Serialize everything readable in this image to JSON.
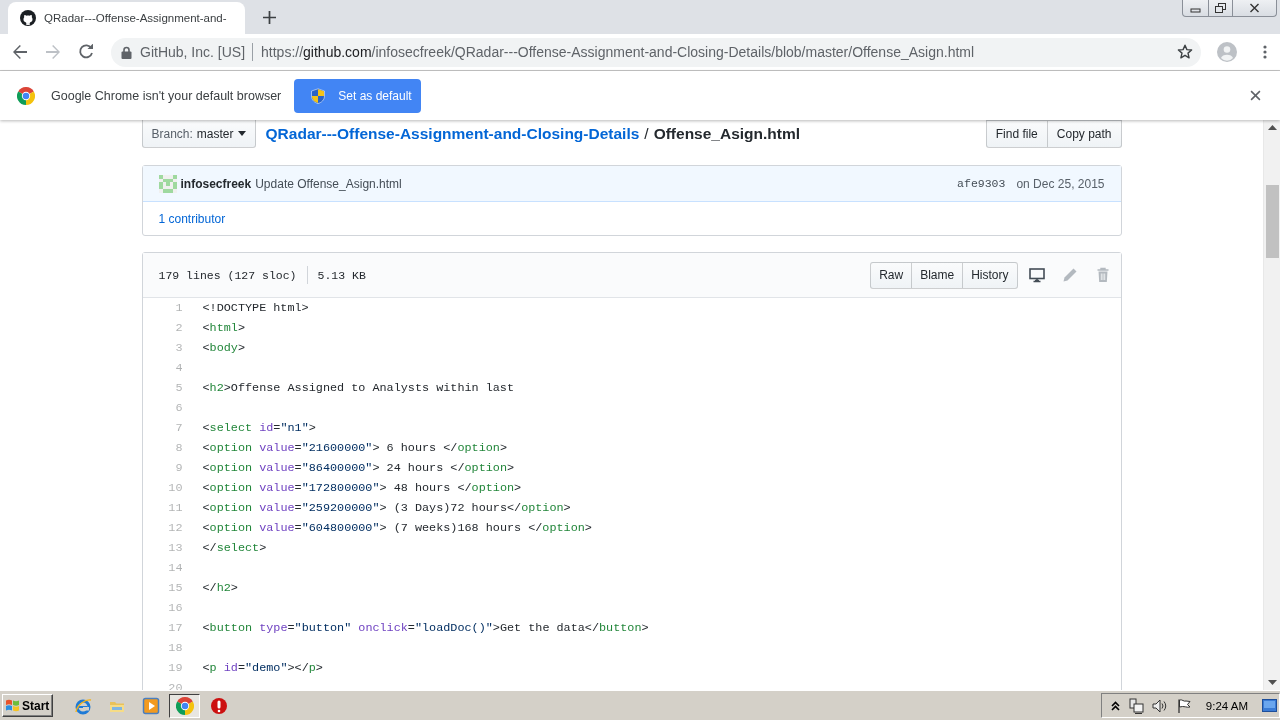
{
  "tabs": [
    {
      "title": "QRadar---Offense-Assignment-and-",
      "selected": true
    }
  ],
  "toolbar": {
    "back_disabled": false,
    "forward_disabled": true,
    "site_identity": "GitHub, Inc. [US]",
    "url": {
      "scheme": "https://",
      "host": "github.com",
      "path": "/infosecfreek/QRadar---Offense-Assignment-and-Closing-Details/blob/master/Offense_Asign.html"
    }
  },
  "infobar": {
    "message": "Google Chrome isn't your default browser",
    "button": "Set as default"
  },
  "file_nav": {
    "branch_label": "Branch:",
    "branch": "master",
    "repo": "QRadar---Offense-Assignment-and-Closing-Details",
    "separator": "/",
    "file": "Offense_Asign.html",
    "buttons": [
      "Find file",
      "Copy path"
    ]
  },
  "commit": {
    "author": "infosecfreek",
    "message": "Update Offense_Asign.html",
    "sha": "afe9303",
    "date": "on Dec 25, 2015",
    "contributors": "1 contributor"
  },
  "file": {
    "lines_info": "179 lines (127 sloc)",
    "size": "5.13 KB",
    "buttons": [
      "Raw",
      "Blame",
      "History"
    ],
    "actions": [
      {
        "disabled": false
      },
      {
        "disabled": true
      },
      {
        "disabled": true
      }
    ],
    "lines": [
      {
        "number": "1",
        "tokens": [
          {
            "kind": "plain",
            "text": "<!DOCTYPE html>"
          }
        ]
      },
      {
        "number": "2",
        "tokens": [
          {
            "kind": "plain",
            "text": "<"
          },
          {
            "kind": "tag",
            "text": "html"
          },
          {
            "kind": "plain",
            "text": ">"
          }
        ]
      },
      {
        "number": "3",
        "tokens": [
          {
            "kind": "plain",
            "text": "<"
          },
          {
            "kind": "tag",
            "text": "body"
          },
          {
            "kind": "plain",
            "text": ">"
          }
        ]
      },
      {
        "number": "4"
      },
      {
        "number": "5",
        "tokens": [
          {
            "kind": "plain",
            "text": "<"
          },
          {
            "kind": "tag",
            "text": "h2"
          },
          {
            "kind": "plain",
            "text": ">Offense Assigned to Analysts within last"
          }
        ]
      },
      {
        "number": "6"
      },
      {
        "number": "7",
        "tokens": [
          {
            "kind": "plain",
            "text": "<"
          },
          {
            "kind": "tag",
            "text": "select"
          },
          {
            "kind": "attr",
            "text": " id"
          },
          {
            "kind": "plain",
            "text": "="
          },
          {
            "kind": "string",
            "text": "\"n1\""
          },
          {
            "kind": "plain",
            "text": ">"
          }
        ]
      },
      {
        "number": "8",
        "tokens": [
          {
            "kind": "plain",
            "text": "<"
          },
          {
            "kind": "tag",
            "text": "option"
          },
          {
            "kind": "attr",
            "text": " value"
          },
          {
            "kind": "plain",
            "text": "="
          },
          {
            "kind": "string",
            "text": "\"21600000\""
          },
          {
            "kind": "plain",
            "text": "> 6 hours </"
          },
          {
            "kind": "tag",
            "text": "option"
          },
          {
            "kind": "plain",
            "text": ">"
          }
        ]
      },
      {
        "number": "9",
        "tokens": [
          {
            "kind": "plain",
            "text": "<"
          },
          {
            "kind": "tag",
            "text": "option"
          },
          {
            "kind": "attr",
            "text": " value"
          },
          {
            "kind": "plain",
            "text": "="
          },
          {
            "kind": "string",
            "text": "\"86400000\""
          },
          {
            "kind": "plain",
            "text": "> 24 hours </"
          },
          {
            "kind": "tag",
            "text": "option"
          },
          {
            "kind": "plain",
            "text": ">"
          }
        ]
      },
      {
        "number": "10",
        "tokens": [
          {
            "kind": "plain",
            "text": "<"
          },
          {
            "kind": "tag",
            "text": "option"
          },
          {
            "kind": "attr",
            "text": " value"
          },
          {
            "kind": "plain",
            "text": "="
          },
          {
            "kind": "string",
            "text": "\"172800000\""
          },
          {
            "kind": "plain",
            "text": "> 48 hours </"
          },
          {
            "kind": "tag",
            "text": "option"
          },
          {
            "kind": "plain",
            "text": ">"
          }
        ]
      },
      {
        "number": "11",
        "tokens": [
          {
            "kind": "plain",
            "text": "<"
          },
          {
            "kind": "tag",
            "text": "option"
          },
          {
            "kind": "attr",
            "text": " value"
          },
          {
            "kind": "plain",
            "text": "="
          },
          {
            "kind": "string",
            "text": "\"259200000\""
          },
          {
            "kind": "plain",
            "text": "> (3 Days)72 hours</"
          },
          {
            "kind": "tag",
            "text": "option"
          },
          {
            "kind": "plain",
            "text": ">"
          }
        ]
      },
      {
        "number": "12",
        "tokens": [
          {
            "kind": "plain",
            "text": "<"
          },
          {
            "kind": "tag",
            "text": "option"
          },
          {
            "kind": "attr",
            "text": " value"
          },
          {
            "kind": "plain",
            "text": "="
          },
          {
            "kind": "string",
            "text": "\"604800000\""
          },
          {
            "kind": "plain",
            "text": "> (7 weeks)168 hours </"
          },
          {
            "kind": "tag",
            "text": "option"
          },
          {
            "kind": "plain",
            "text": ">"
          }
        ]
      },
      {
        "number": "13",
        "tokens": [
          {
            "kind": "plain",
            "text": "</"
          },
          {
            "kind": "tag",
            "text": "select"
          },
          {
            "kind": "plain",
            "text": ">"
          }
        ]
      },
      {
        "number": "14"
      },
      {
        "number": "15",
        "tokens": [
          {
            "kind": "plain",
            "text": "</"
          },
          {
            "kind": "tag",
            "text": "h2"
          },
          {
            "kind": "plain",
            "text": ">"
          }
        ]
      },
      {
        "number": "16"
      },
      {
        "number": "17",
        "tokens": [
          {
            "kind": "plain",
            "text": "<"
          },
          {
            "kind": "tag",
            "text": "button"
          },
          {
            "kind": "attr",
            "text": " type"
          },
          {
            "kind": "plain",
            "text": "="
          },
          {
            "kind": "string",
            "text": "\"button\""
          },
          {
            "kind": "attr",
            "text": " onclick"
          },
          {
            "kind": "plain",
            "text": "="
          },
          {
            "kind": "string",
            "text": "\"loadDoc()\""
          },
          {
            "kind": "plain",
            "text": ">Get the data</"
          },
          {
            "kind": "tag",
            "text": "button"
          },
          {
            "kind": "plain",
            "text": ">"
          }
        ]
      },
      {
        "number": "18"
      },
      {
        "number": "19",
        "tokens": [
          {
            "kind": "plain",
            "text": "<"
          },
          {
            "kind": "tag",
            "text": "p"
          },
          {
            "kind": "attr",
            "text": " id"
          },
          {
            "kind": "plain",
            "text": "="
          },
          {
            "kind": "string",
            "text": "\"demo\""
          },
          {
            "kind": "plain",
            "text": "></"
          },
          {
            "kind": "tag",
            "text": "p"
          },
          {
            "kind": "plain",
            "text": ">"
          }
        ]
      },
      {
        "number": "20"
      }
    ]
  },
  "taskbar": {
    "start": "Start",
    "apps": [
      {
        "selected": false
      },
      {
        "selected": false
      },
      {
        "selected": false
      },
      {
        "selected": true
      },
      {
        "selected": false
      }
    ],
    "clock": "9:24 AM"
  }
}
